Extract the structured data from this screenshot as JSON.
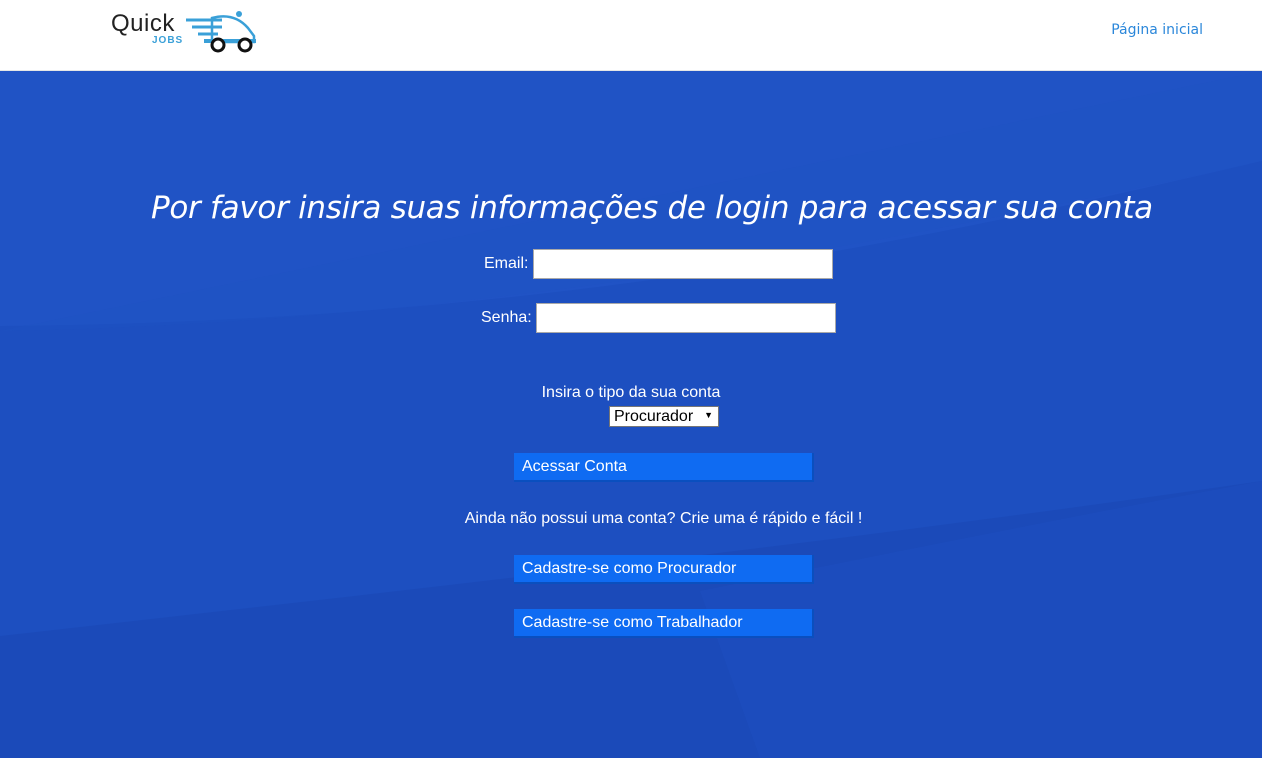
{
  "header": {
    "logo_quick": "Quick",
    "logo_jobs": "JOBS",
    "nav_home": "Página inicial"
  },
  "main": {
    "headline": "Por favor insira suas informações de login para acessar sua conta",
    "email_label": "Email:",
    "email_value": "",
    "password_label": "Senha:",
    "password_value": "",
    "account_type_label": "Insira o tipo da sua conta",
    "account_type_selected": "Procurador",
    "login_button": "Acessar Conta",
    "signup_prompt": "Ainda não possui uma conta? Crie uma é rápido e fácil !",
    "signup_procurador_button": "Cadastre-se como Procurador",
    "signup_trabalhador_button": "Cadastre-se como Trabalhador"
  },
  "colors": {
    "hero_bg": "#1d4fc0",
    "button_bg": "#0f6bf2",
    "nav_link": "#2b87da"
  }
}
